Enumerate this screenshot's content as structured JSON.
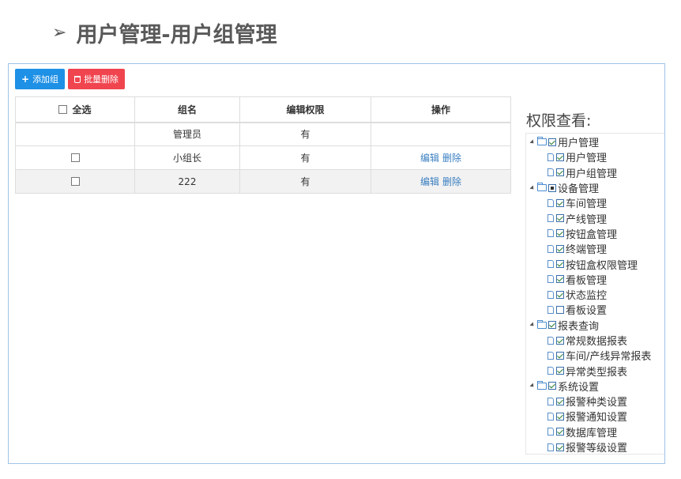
{
  "heading": {
    "arrow": "➢",
    "title": "用户管理-用户组管理"
  },
  "toolbar": {
    "add_label": "添加组",
    "add_icon": "plus-icon",
    "delete_label": "批量删除",
    "delete_icon": "trash-icon",
    "add_color": "#1e90e6",
    "delete_color": "#f0454f"
  },
  "table": {
    "headers": [
      "全选",
      "组名",
      "编辑权限",
      "操作"
    ],
    "rows": [
      {
        "has_checkbox": false,
        "name": "管理员",
        "perm": "有",
        "edit": "",
        "delete": ""
      },
      {
        "has_checkbox": true,
        "name": "小组长",
        "perm": "有",
        "edit": "编辑",
        "delete": "删除"
      },
      {
        "has_checkbox": true,
        "name": "222",
        "perm": "有",
        "edit": "编辑",
        "delete": "删除"
      }
    ]
  },
  "permissions": {
    "title": "权限查看:",
    "tree": [
      {
        "label": "用户管理",
        "state": "checked",
        "children": [
          {
            "label": "用户管理",
            "state": "checked"
          },
          {
            "label": "用户组管理",
            "state": "checked"
          }
        ]
      },
      {
        "label": "设备管理",
        "state": "partial",
        "children": [
          {
            "label": "车间管理",
            "state": "checked"
          },
          {
            "label": "产线管理",
            "state": "checked"
          },
          {
            "label": "按钮盒管理",
            "state": "checked"
          },
          {
            "label": "终端管理",
            "state": "checked"
          },
          {
            "label": "按钮盒权限管理",
            "state": "checked"
          },
          {
            "label": "看板管理",
            "state": "checked"
          },
          {
            "label": "状态监控",
            "state": "checked"
          },
          {
            "label": "看板设置",
            "state": "unchecked"
          }
        ]
      },
      {
        "label": "报表查询",
        "state": "checked",
        "children": [
          {
            "label": "常规数据报表",
            "state": "checked"
          },
          {
            "label": "车间/产线异常报表",
            "state": "checked"
          },
          {
            "label": "异常类型报表",
            "state": "checked"
          }
        ]
      },
      {
        "label": "系统设置",
        "state": "checked",
        "children": [
          {
            "label": "报警种类设置",
            "state": "checked"
          },
          {
            "label": "报警通知设置",
            "state": "checked"
          },
          {
            "label": "数据库管理",
            "state": "checked"
          },
          {
            "label": "报警等级设置",
            "state": "checked"
          }
        ]
      }
    ]
  }
}
